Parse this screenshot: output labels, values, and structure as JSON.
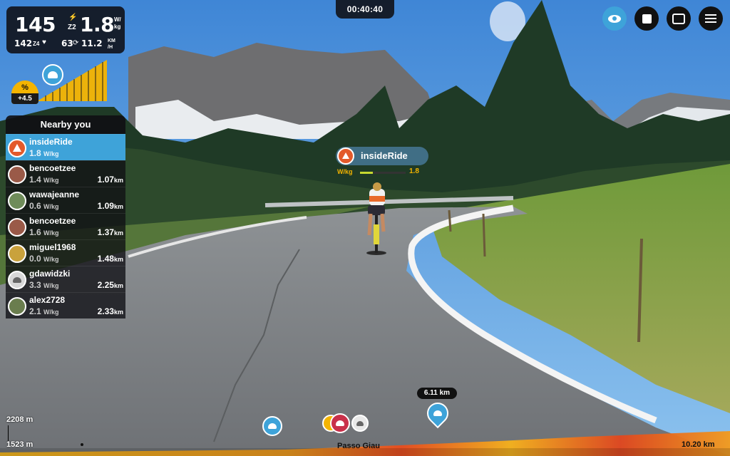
{
  "stats": {
    "power": "145",
    "power_zone": "Z2",
    "wkg": "1.8",
    "wkg_unit_top": "W/",
    "wkg_unit_bottom": "kg",
    "heart_rate": "142",
    "hr_zone": "Z4",
    "cadence": "63",
    "speed": "11.2",
    "speed_unit_top": "KM",
    "speed_unit_bottom": "/H"
  },
  "gradient": {
    "label": "%",
    "value": "+4.5"
  },
  "timer": "00:40:40",
  "top_buttons": [
    "eye-icon",
    "stop-icon",
    "chat-icon",
    "menu-icon"
  ],
  "nearby": {
    "title": "Nearby you",
    "riders": [
      {
        "name": "insideRide",
        "wkg": "1.8",
        "unit": "W/kg",
        "dist": "",
        "dist_unit": "",
        "active": true
      },
      {
        "name": "bencoetzee",
        "wkg": "1.4",
        "unit": "W/kg",
        "dist": "1.07",
        "dist_unit": "km"
      },
      {
        "name": "wawajeanne",
        "wkg": "0.6",
        "unit": "W/kg",
        "dist": "1.09",
        "dist_unit": "km"
      },
      {
        "name": "bencoetzee",
        "wkg": "1.6",
        "unit": "W/kg",
        "dist": "1.37",
        "dist_unit": "km"
      },
      {
        "name": "miguel1968",
        "wkg": "0.0",
        "unit": "W/kg",
        "dist": "1.48",
        "dist_unit": "km"
      },
      {
        "name": "gdawidzki",
        "wkg": "3.3",
        "unit": "W/kg",
        "dist": "2.25",
        "dist_unit": "km"
      },
      {
        "name": "alex2728",
        "wkg": "2.1",
        "unit": "W/kg",
        "dist": "2.33",
        "dist_unit": "km"
      }
    ]
  },
  "rider_tag": {
    "name": "insideRide",
    "unit": "W/kg",
    "value": "1.8"
  },
  "elevation": {
    "max": "2208 m",
    "min": "1523 m",
    "location": "Passo Giau",
    "total_distance": "10.20 km",
    "marker_distance": "6.11 km"
  },
  "colors": {
    "accent_blue": "#3ea3d9",
    "highlight_yellow": "#f4b400",
    "active_orange": "#e35a2b",
    "profile_red": "#e0471f"
  }
}
